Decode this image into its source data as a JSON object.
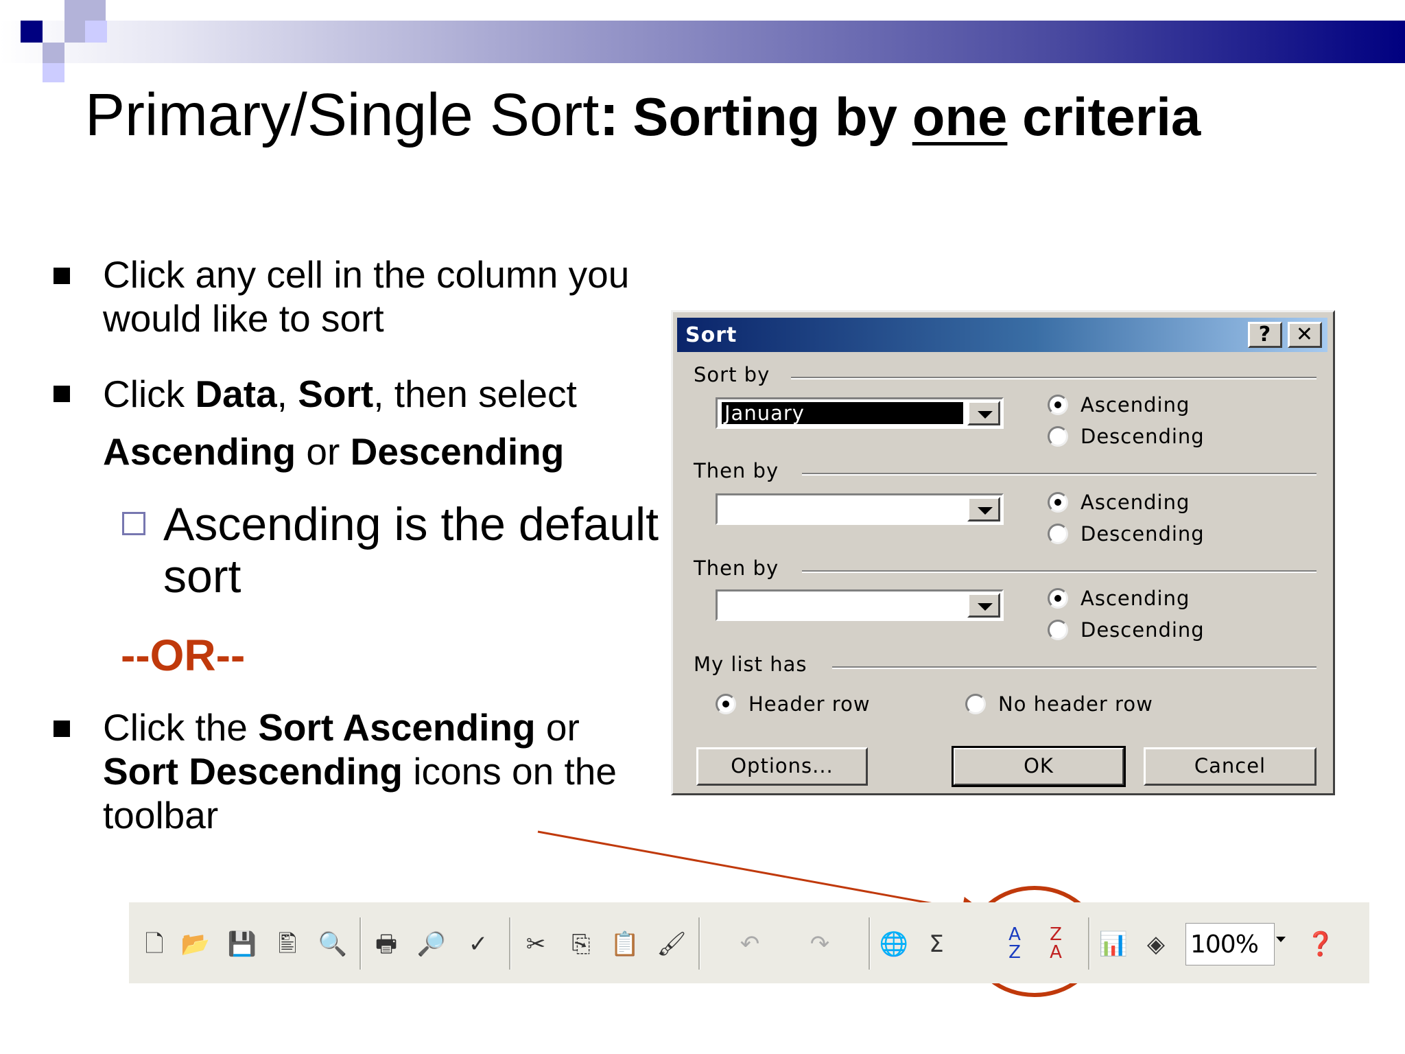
{
  "slide": {
    "title_main": "Primary/Single Sort",
    "title_colon": ":",
    "title_sub_1": "Sorting by ",
    "title_sub_underlined": "one",
    "title_sub_2": " criteria"
  },
  "bullets": {
    "b1": "Click any cell in the column you would like to sort",
    "b2_prefix": "Click ",
    "b2_data": "Data",
    "b2_comma": ", ",
    "b2_sort": "Sort",
    "b2_then": ", then select ",
    "b2_asc": "Ascending",
    "b2_or": " or ",
    "b2_desc": "Descending",
    "sub": "Ascending is the default sort",
    "or": "--OR--",
    "b3_prefix": "Click the ",
    "b3_asc": "Sort Ascending",
    "b3_or": " or ",
    "b3_desc": "Sort Descending",
    "b3_suffix": " icons on the toolbar"
  },
  "dialog": {
    "title": "Sort",
    "help_btn": "?",
    "close_btn": "✕",
    "sort_by_label": "Sort by",
    "sort_by_value": "January",
    "then_by_1_label": "Then by",
    "then_by_2_label": "Then by",
    "ascending": "Ascending",
    "descending": "Descending",
    "my_list_has_label": "My list has",
    "header_row": "Header row",
    "no_header_row": "No header row",
    "options_btn": "Options...",
    "ok_btn": "OK",
    "cancel_btn": "Cancel"
  },
  "toolbar": {
    "zoom": "100%",
    "icons": [
      "new-icon",
      "open-icon",
      "save-icon",
      "permission-icon",
      "print-preview-icon",
      "print-icon",
      "preview-icon",
      "spelling-icon",
      "cut-icon",
      "copy-icon",
      "paste-icon",
      "format-painter-icon",
      "undo-icon",
      "redo-icon",
      "hyperlink-icon",
      "autosum-icon",
      "sort-ascending-icon",
      "sort-descending-icon",
      "chart-wizard-icon",
      "drawing-icon",
      "help-icon"
    ]
  },
  "colors": {
    "accent_orange": "#c0390b",
    "title_bar": "#0a246a",
    "slide_band": "#000080"
  }
}
